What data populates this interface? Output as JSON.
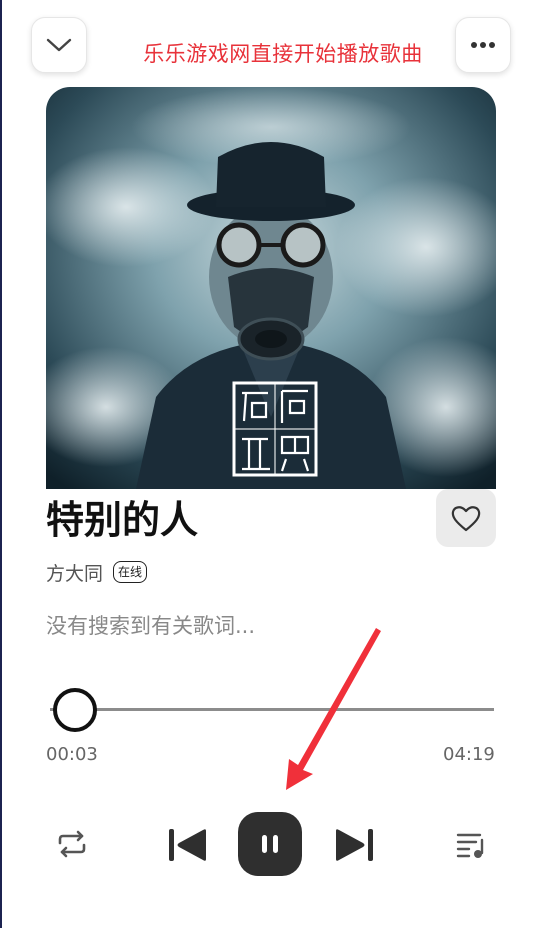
{
  "banner": {
    "text": "乐乐游戏网直接开始播放歌曲",
    "color": "#e8323a"
  },
  "header": {
    "collapse_icon": "chevron-down-icon",
    "more_icon": "more-horizontal-icon"
  },
  "cover": {
    "art_text": "危险世界"
  },
  "song": {
    "title": "特别的人",
    "artist": "方大同",
    "badge": "在线",
    "lyrics_placeholder": "没有搜索到有关歌词..."
  },
  "progress": {
    "current": "00:03",
    "duration": "04:19",
    "fraction": 0.012
  },
  "controls": {
    "repeat_icon": "repeat-icon",
    "prev_icon": "skip-previous-icon",
    "play_pause_icon": "pause-icon",
    "next_icon": "skip-next-icon",
    "queue_icon": "playlist-icon",
    "like_icon": "heart-outline-icon"
  },
  "colors": {
    "accent": "#2f2f2f",
    "annotation_arrow": "#f0303a"
  }
}
